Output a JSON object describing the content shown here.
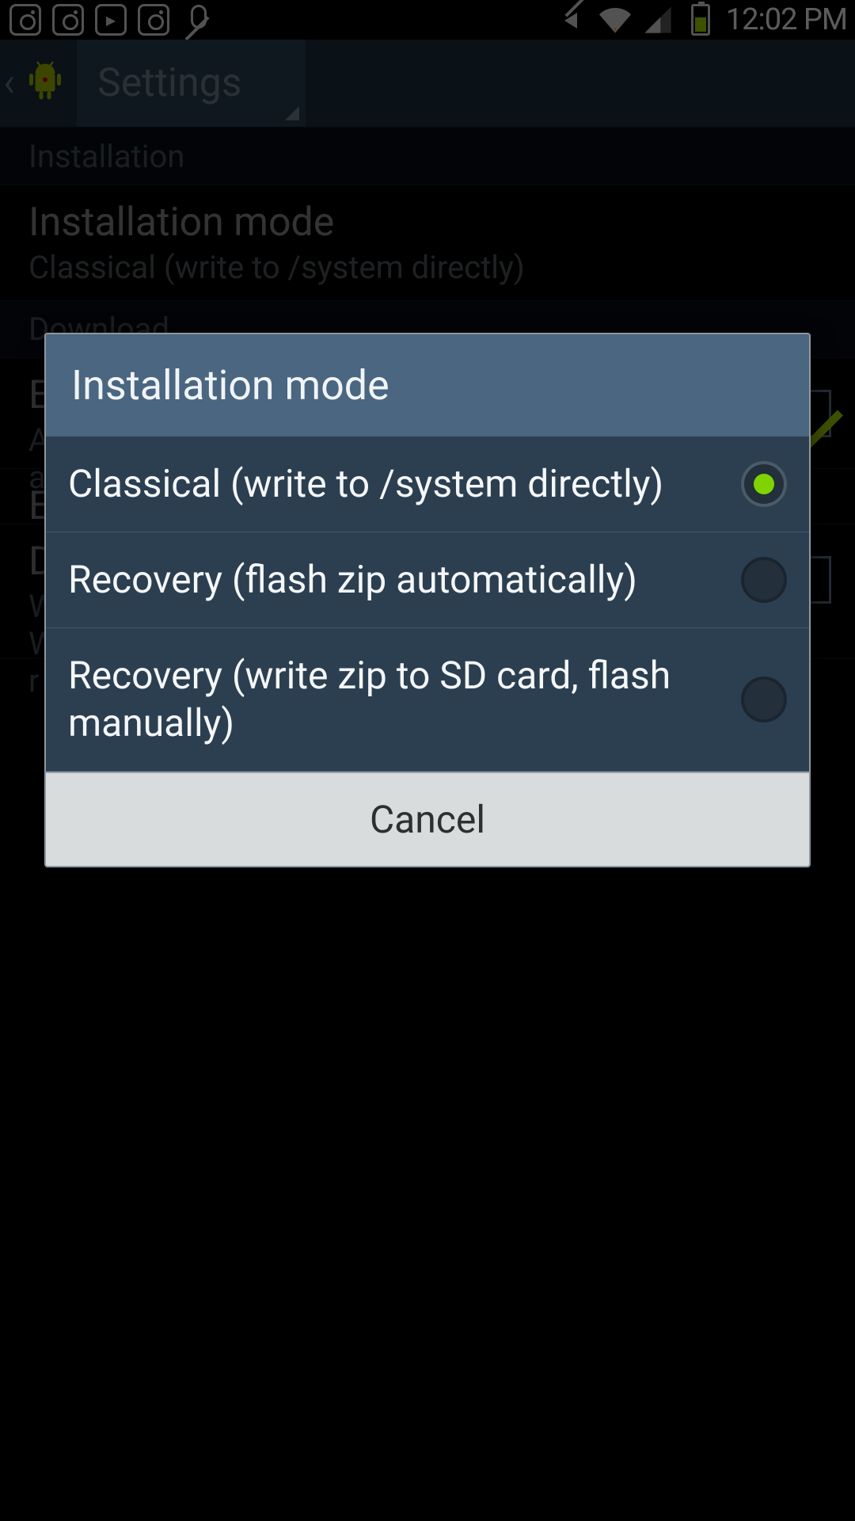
{
  "statusbar": {
    "time": "12:02 PM"
  },
  "actionbar": {
    "title": "Settings"
  },
  "sections": {
    "installation_header": "Installation",
    "installation_mode": {
      "title": "Installation mode",
      "subtitle": "Classical (write to /system directly)"
    },
    "download_header": "Download"
  },
  "dialog": {
    "title": "Installation mode",
    "options": [
      {
        "label": "Classical (write to /system directly)",
        "selected": true
      },
      {
        "label": "Recovery (flash zip automatically)",
        "selected": false
      },
      {
        "label": "Recovery (write zip to SD card, flash manually)",
        "selected": false
      }
    ],
    "cancel": "Cancel"
  }
}
